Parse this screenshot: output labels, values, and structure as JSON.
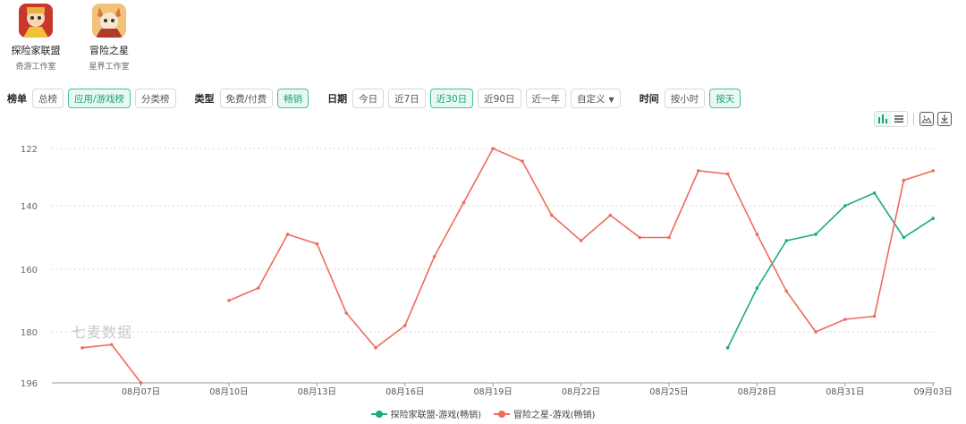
{
  "apps": [
    {
      "name": "探险家联盟",
      "developer": "奇游工作室",
      "icon": "explorer-alliance-app-icon"
    },
    {
      "name": "冒险之星",
      "developer": "星界工作室",
      "icon": "adventure-star-app-icon"
    }
  ],
  "filters": {
    "ranking": {
      "label": "榜单",
      "options": [
        "总榜",
        "应用/游戏榜",
        "分类榜"
      ],
      "active": "应用/游戏榜"
    },
    "type": {
      "label": "类型",
      "options": [
        "免费/付费",
        "畅销"
      ],
      "active": "畅销"
    },
    "date": {
      "label": "日期",
      "options": [
        "今日",
        "近7日",
        "近30日",
        "近90日",
        "近一年"
      ],
      "custom": "自定义",
      "active": "近30日"
    },
    "time": {
      "label": "时间",
      "options": [
        "按小时",
        "按天"
      ],
      "active": "按天"
    }
  },
  "toolbar": {
    "icons": [
      "bar-line-toggle-icon",
      "table-view-icon",
      "image-export-icon",
      "download-icon"
    ]
  },
  "watermark": "七麦数据",
  "colors": {
    "accent": "#14a37f",
    "series1": "#1bab7f",
    "series2": "#ee6b5e",
    "grid": "#d6d6d6"
  },
  "chart_data": {
    "type": "line",
    "x": [
      "08月05日",
      "08月06日",
      "08月07日",
      "08月08日",
      "08月09日",
      "08月10日",
      "08月11日",
      "08月12日",
      "08月13日",
      "08月14日",
      "08月15日",
      "08月16日",
      "08月17日",
      "08月18日",
      "08月19日",
      "08月20日",
      "08月21日",
      "08月22日",
      "08月23日",
      "08月24日",
      "08月25日",
      "08月26日",
      "08月27日",
      "08月28日",
      "08月29日",
      "08月30日",
      "08月31日",
      "09月01日",
      "09月02日",
      "09月03日"
    ],
    "x_tick_labels": [
      "08月07日",
      "08月10日",
      "08月13日",
      "08月16日",
      "08月19日",
      "08月22日",
      "08月25日",
      "08月28日",
      "08月31日",
      "09月03日"
    ],
    "y_ticks": [
      122,
      140,
      160,
      180,
      196
    ],
    "ylim": [
      196,
      122
    ],
    "y_reversed": true,
    "grid": "horizontal dotted",
    "legend_position": "bottom",
    "series": [
      {
        "name": "探险家联盟-游戏(畅销)",
        "color": "#1bab7f",
        "values": [
          null,
          null,
          null,
          null,
          null,
          null,
          null,
          null,
          null,
          null,
          null,
          null,
          null,
          null,
          null,
          null,
          null,
          null,
          null,
          null,
          null,
          null,
          185,
          166,
          151,
          149,
          140,
          136,
          150,
          144
        ]
      },
      {
        "name": "冒险之星-游戏(畅销)",
        "color": "#ee6b5e",
        "values": [
          185,
          184,
          196,
          null,
          null,
          170,
          166,
          149,
          152,
          174,
          185,
          178,
          156,
          139,
          122,
          126,
          143,
          151,
          143,
          150,
          150,
          129,
          130,
          149,
          167,
          180,
          176,
          175,
          132,
          129
        ]
      }
    ]
  }
}
